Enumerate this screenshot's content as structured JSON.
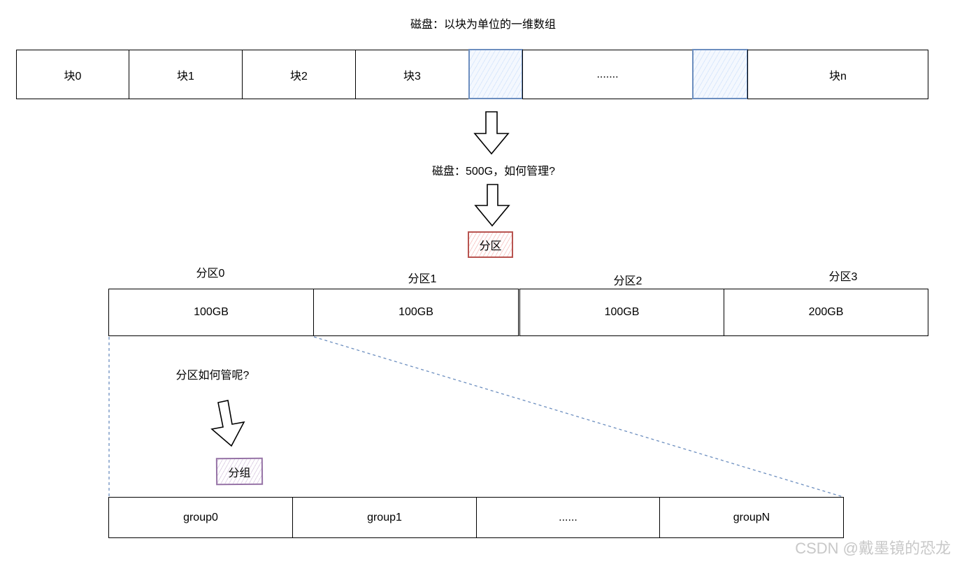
{
  "disk": {
    "title": "磁盘：以块为单位的一维数组",
    "blocks": [
      "块0",
      "块1",
      "块2",
      "块3",
      "",
      ".......",
      "",
      "块n"
    ]
  },
  "question1": "磁盘：500G，如何管理?",
  "partition_tag": "分区",
  "partitions": [
    {
      "label": "分区0",
      "size": "100GB"
    },
    {
      "label": "分区1",
      "size": "100GB"
    },
    {
      "label": "分区2",
      "size": "100GB"
    },
    {
      "label": "分区3",
      "size": "200GB"
    }
  ],
  "question2": "分区如何管呢?",
  "group_tag": "分组",
  "groups": [
    "group0",
    "group1",
    "......",
    "groupN"
  ],
  "watermark": "CSDN @戴墨镜的恐龙",
  "colors": {
    "blue_stroke": "#6c8ebf",
    "blue_fill": "#dae8fc",
    "red_stroke": "#b85450",
    "red_fill": "#f8cecc",
    "purple_stroke": "#9673a6",
    "purple_fill": "#e1d5e7"
  }
}
